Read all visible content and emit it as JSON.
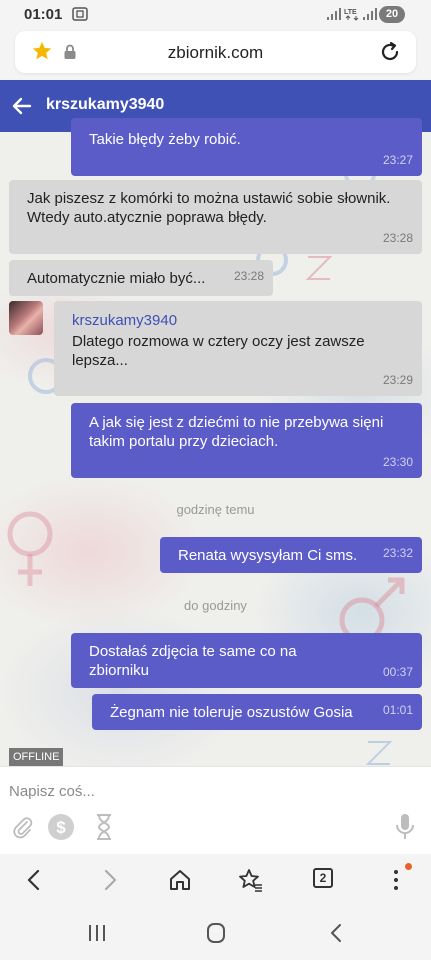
{
  "status_bar": {
    "time": "01:01",
    "battery": "20"
  },
  "browser": {
    "url": "zbiornik.com",
    "tab_count": "2"
  },
  "chat": {
    "title": "krszukamy3940"
  },
  "messages": [
    {
      "direction": "out",
      "text": "Takie błędy żeby robić.",
      "time": "23:27"
    },
    {
      "direction": "in",
      "text": "Jak piszesz z komórki to można ustawić sobie słownik. Wtedy auto.atycznie poprawa błędy.",
      "time": "23:28"
    },
    {
      "direction": "in",
      "text": "Automatycznie miało być...",
      "time": "23:28"
    },
    {
      "direction": "in",
      "sender": "krszukamy3940",
      "text": "Dlatego rozmowa w cztery oczy jest zawsze lepsza...",
      "time": "23:29"
    },
    {
      "direction": "out",
      "text": "A jak się jest z dziećmi to nie przebywa sięni takim portalu przy dzieciach.",
      "time": "23:30"
    },
    {
      "direction": "out",
      "text": "Renata wysysyłam Ci sms.",
      "time": "23:32"
    },
    {
      "direction": "out",
      "text": "Dostałaś zdjęcia te same co na zbiorniku",
      "time": "00:37"
    },
    {
      "direction": "out",
      "text": "Żegnam nie toleruje oszustów Gosia",
      "time": "01:01"
    }
  ],
  "dividers": [
    "godzinę temu",
    "do godziny"
  ],
  "presence": "OFFLINE",
  "composer": {
    "placeholder": "Napisz coś..."
  },
  "colors": {
    "header": "#3f51b5",
    "outgoing_bubble": "#5c5cc8",
    "incoming_bubble": "#d7d7d7",
    "notification_dot": "#e8632b"
  },
  "icons": {
    "url_bar": [
      "star-icon",
      "lock-icon",
      "reload-icon"
    ],
    "composer": [
      "paperclip-icon",
      "dollar-icon",
      "hourglass-icon",
      "microphone-icon"
    ],
    "browser_nav": [
      "back-arrow-icon",
      "forward-arrow-icon",
      "home-icon",
      "bookmarks-icon",
      "tabs-icon",
      "more-icon"
    ],
    "system_nav": [
      "recent-apps-icon",
      "home-button-icon",
      "system-back-icon"
    ]
  }
}
